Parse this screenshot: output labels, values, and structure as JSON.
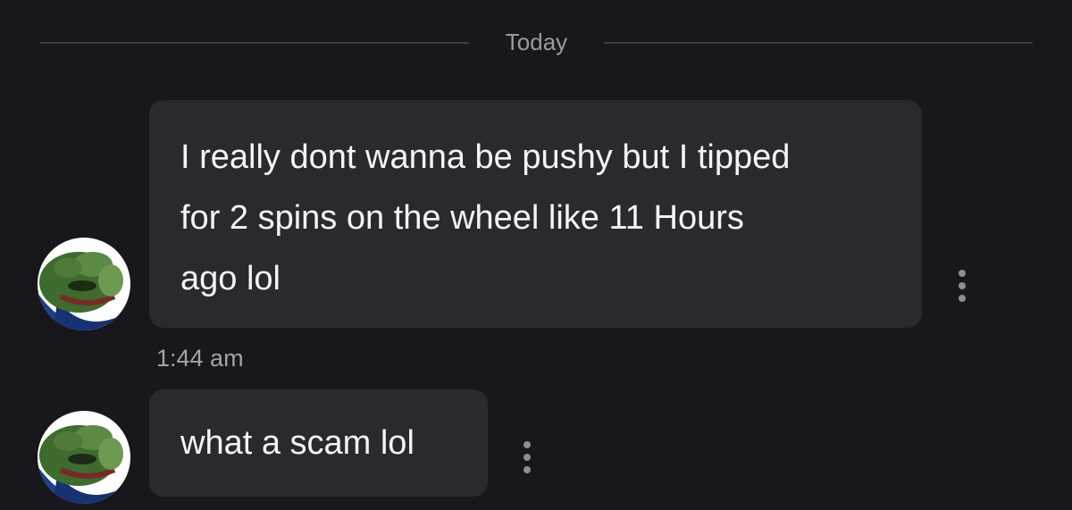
{
  "date_divider": {
    "label": "Today"
  },
  "messages": [
    {
      "text": "I really dont wanna be pushy but I tipped\nfor 2 spins on the wheel like 11 Hours\nago lol",
      "avatar_icon": "pepe-frog-avatar",
      "menu_icon": "more-vertical-icon"
    },
    {
      "text": "what a scam lol",
      "avatar_icon": "pepe-frog-avatar",
      "menu_icon": "more-vertical-icon"
    }
  ],
  "timestamp": "1:44 am",
  "colors": {
    "background": "#18171c",
    "bubble": "#2a2930",
    "text": "#f4f4f6",
    "muted": "#9b9aa2",
    "avatar_green": "#4f7a3a",
    "avatar_blue": "#1f3f8a"
  }
}
